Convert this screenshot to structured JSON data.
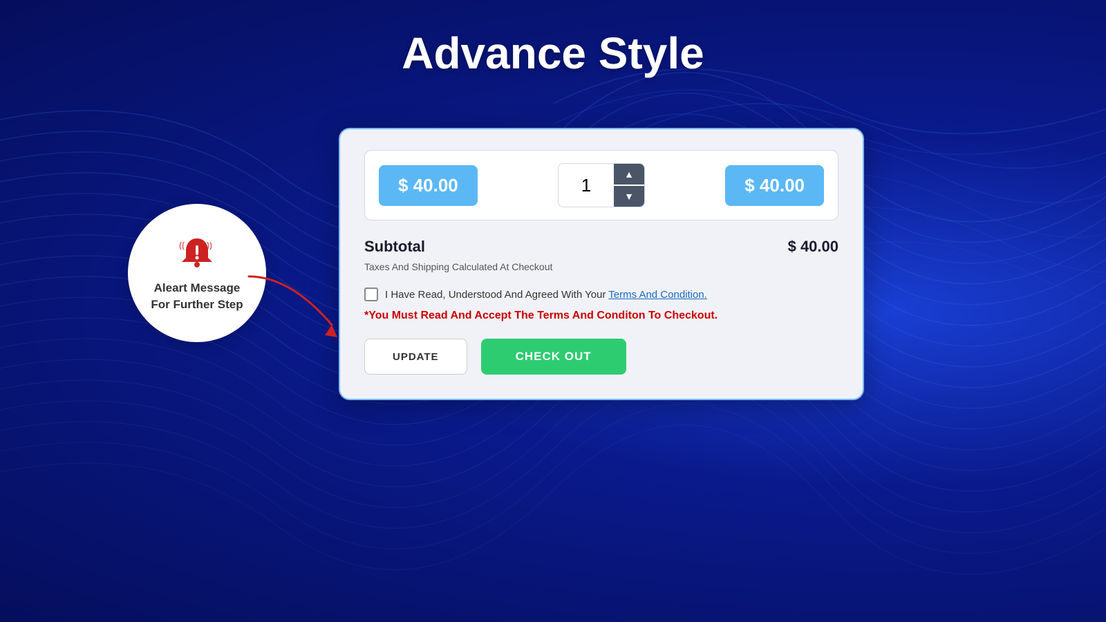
{
  "page": {
    "title": "Advance Style",
    "background_color": "#0a1a8c"
  },
  "product_row": {
    "unit_price": "$ 40.00",
    "quantity": "1",
    "total_price": "$ 40.00"
  },
  "subtotal": {
    "label": "Subtotal",
    "value": "$ 40.00",
    "tax_note": "Taxes And Shipping Calculated At Checkout"
  },
  "terms": {
    "checkbox_label": "I Have Read, Understood And Agreed With Your",
    "link_text": "Terms And Condition.",
    "alert_message": "*You Must Read And Accept The Terms And Conditon To Checkout."
  },
  "buttons": {
    "update_label": "UPDATE",
    "checkout_label": "CHECK OUT"
  },
  "alert_bubble": {
    "line1": "Aleart Message",
    "line2": "For Further Step"
  },
  "qty_buttons": {
    "up": "▲",
    "down": "▼"
  }
}
